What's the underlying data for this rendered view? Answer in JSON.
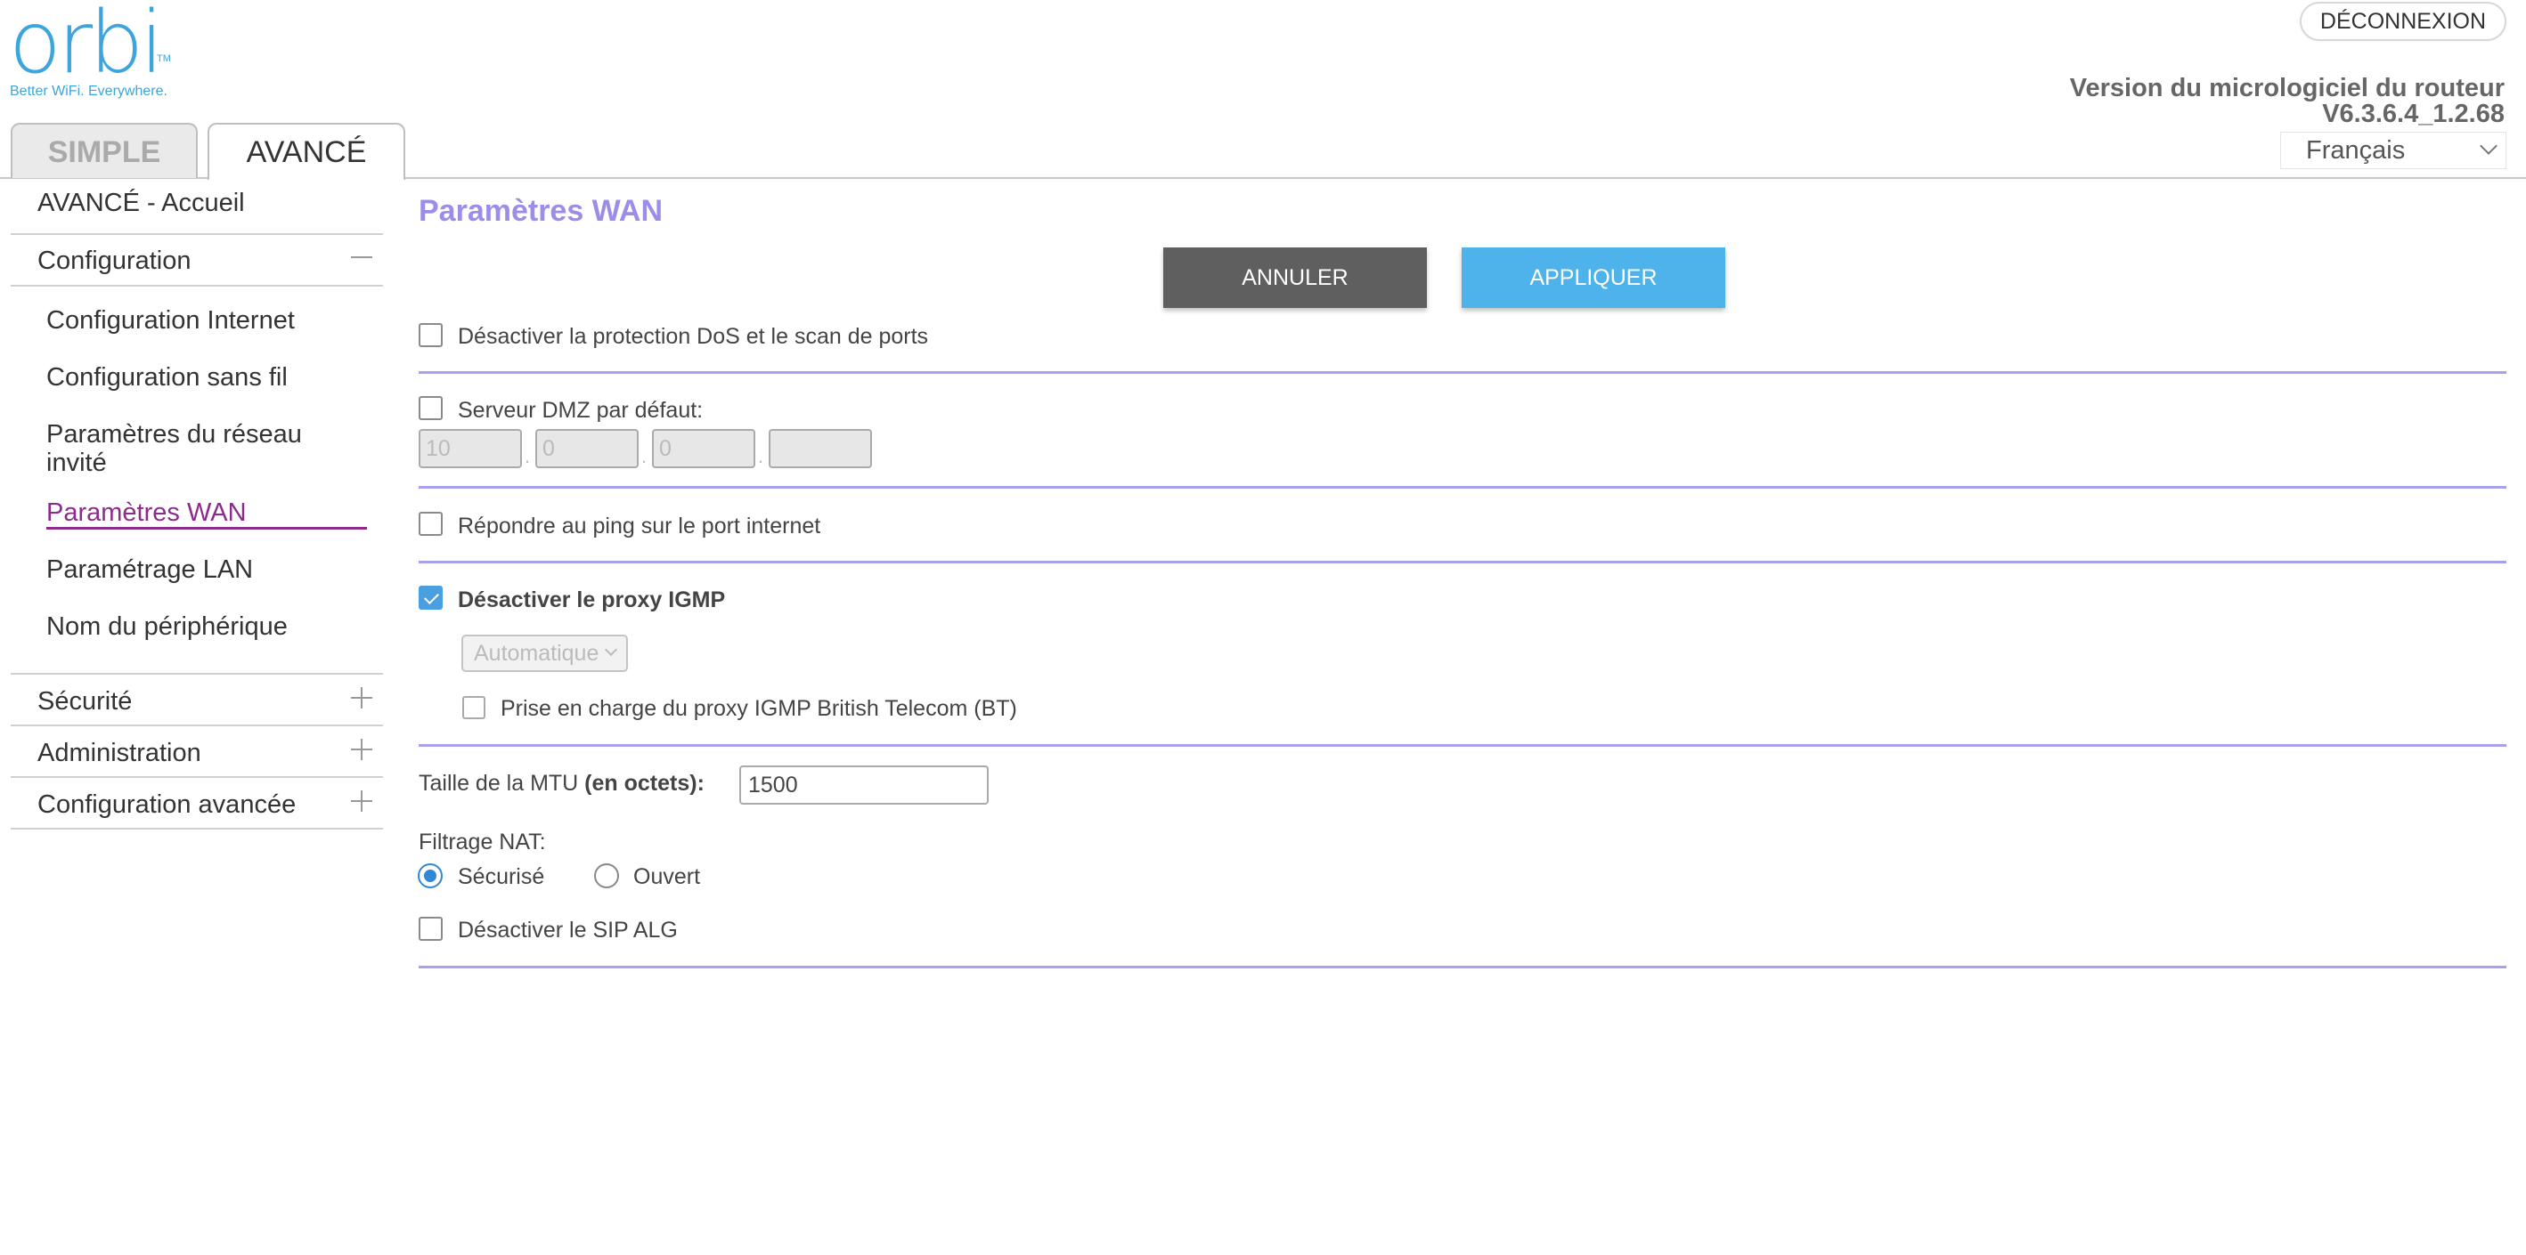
{
  "header": {
    "logo_text": "orbi",
    "logo_tm": "TM",
    "tagline": "Better WiFi. Everywhere.",
    "logout_label": "DÉCONNEXION",
    "firmware_label": "Version du micrologiciel du routeur",
    "firmware_version": "V6.3.6.4_1.2.68",
    "language": "Français"
  },
  "tabs": [
    {
      "label": "SIMPLE",
      "active": false
    },
    {
      "label": "AVANCÉ",
      "active": true
    }
  ],
  "sidebar": {
    "home": "AVANCÉ - Accueil",
    "configuration": {
      "label": "Configuration",
      "items": [
        "Configuration Internet",
        "Configuration sans fil",
        "Paramètres du réseau invité",
        "Paramètres WAN",
        "Paramétrage LAN",
        "Nom du périphérique"
      ],
      "active_item": "Paramètres WAN"
    },
    "security": "Sécurité",
    "administration": "Administration",
    "advanced_config": "Configuration avancée"
  },
  "main": {
    "title": "Paramètres WAN",
    "cancel_label": "ANNULER",
    "apply_label": "APPLIQUER",
    "dos": {
      "label": "Désactiver la protection DoS et le scan de ports",
      "checked": false
    },
    "dmz": {
      "label": "Serveur DMZ par défaut:",
      "checked": false,
      "ip": [
        "10",
        "0",
        "0",
        ""
      ]
    },
    "ping": {
      "label": "Répondre au ping sur le port internet",
      "checked": false
    },
    "igmp": {
      "label": "Désactiver le proxy IGMP",
      "checked": true,
      "mode": "Automatique",
      "bt_label": "Prise en charge du proxy IGMP British Telecom (BT)",
      "bt_checked": false
    },
    "mtu": {
      "label_prefix": "Taille de la MTU ",
      "label_bold": "(en octets)",
      "label_suffix": ":",
      "value": "1500"
    },
    "nat": {
      "label": "Filtrage NAT:",
      "options": [
        "Sécurisé",
        "Ouvert"
      ],
      "selected": "Sécurisé"
    },
    "sip": {
      "label": "Désactiver le SIP ALG",
      "checked": false
    }
  },
  "colors": {
    "brand": "#3ea5dc",
    "title": "#9a8ee8",
    "active_nav": "#8b2c8c",
    "apply": "#4db3ea",
    "cancel": "#5f5f5f",
    "divider": "#a7a0ea"
  }
}
